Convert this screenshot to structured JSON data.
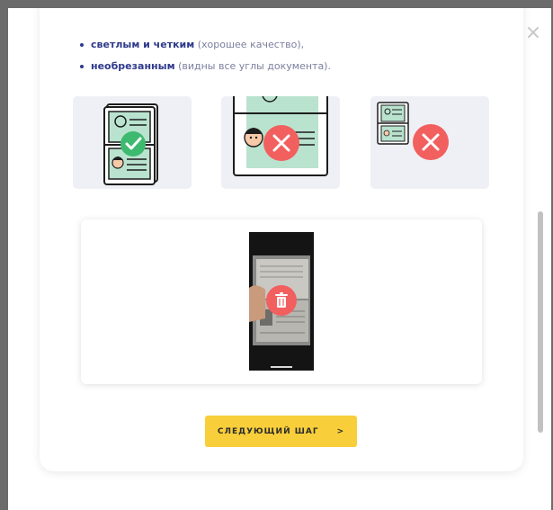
{
  "requirements": [
    {
      "bold": "светлым и четким",
      "note": " (хорошее качество),"
    },
    {
      "bold": "необрезанным",
      "note": " (видны все углы документа)."
    }
  ],
  "examples": [
    {
      "status": "good",
      "icon": "check-icon"
    },
    {
      "status": "bad",
      "icon": "cross-icon"
    },
    {
      "status": "bad",
      "icon": "cross-icon"
    }
  ],
  "upload": {
    "delete_icon": "trash-icon"
  },
  "next_button": {
    "label": "СЛЕДУЮЩИЙ ШАГ",
    "arrow": ">"
  },
  "close_label": "×",
  "colors": {
    "accent": "#f8cf3a",
    "primary": "#2e3a8c",
    "good": "#3dba6f",
    "bad": "#f25f5f"
  }
}
